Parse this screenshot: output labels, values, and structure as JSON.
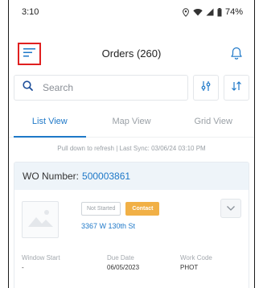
{
  "status_bar": {
    "time": "3:10",
    "battery": "74%"
  },
  "header": {
    "title": "Orders (260)",
    "menu_icon": "hamburger-menu-icon",
    "notification_icon": "bell-icon",
    "menu_highlight_color": "#e02020"
  },
  "search": {
    "placeholder": "Search",
    "filter_icon": "filter-sliders-icon",
    "sort_icon": "sort-arrows-icon"
  },
  "tabs": [
    {
      "label": "List View",
      "active": true
    },
    {
      "label": "Map View",
      "active": false
    },
    {
      "label": "Grid View",
      "active": false
    }
  ],
  "sync_text": "Pull down to refresh | Last Sync: 03/06/24 03:10 PM",
  "order": {
    "wo_label": "WO Number:",
    "wo_number": "500003861",
    "status": "Not Started",
    "contact_label": "Contact",
    "address": "3367 W 130th St",
    "window_start_label": "Window Start",
    "window_start_value": "-",
    "due_date_label": "Due Date",
    "due_date_value": "06/05/2023",
    "work_code_label": "Work Code",
    "work_code_value": "PHOT"
  },
  "colors": {
    "accent": "#1e78c8",
    "contact_badge": "#f1b046",
    "card_header_bg": "#eef4f9"
  }
}
